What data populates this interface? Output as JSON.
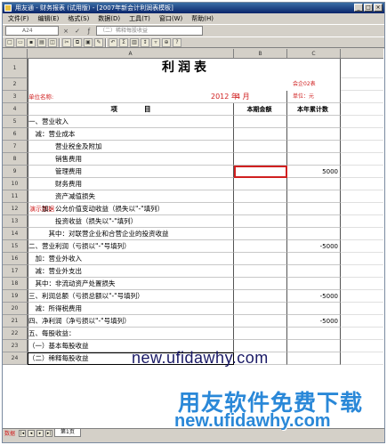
{
  "window": {
    "title": "用友通 - 财务报表 (试用版) - [2007年新会计利润表模板]",
    "buttons": [
      "_",
      "□",
      "×"
    ]
  },
  "menu": [
    "文件(F)",
    "编辑(E)",
    "格式(S)",
    "数据(D)",
    "工具(T)",
    "窗口(W)",
    "帮助(H)"
  ],
  "formula": {
    "cell_ref": "A24",
    "content": "（二）稀释每股收益"
  },
  "toolbar_icons": [
    "new-icon",
    "open-icon",
    "save-icon",
    "print-icon",
    "preview-icon",
    "cut-icon",
    "copy-icon",
    "paste-icon",
    "format-icon",
    "undo-icon",
    "sum-icon",
    "chart-icon",
    "sort-icon",
    "filter-icon",
    "zoom-icon",
    "help-icon"
  ],
  "columns": [
    "A",
    "B",
    "C"
  ],
  "sheet": {
    "title": "利润表",
    "company_label": "单位名称:",
    "year": "2012 年",
    "month": "4 月",
    "form_no": "会企02表",
    "unit": "单位：元",
    "header_item": "项　　　　目",
    "header_current": "本期金额",
    "header_ytd": "本年累计数",
    "demo_label": "演示数据",
    "rows": [
      {
        "n": "5",
        "label": "一、营业收入",
        "b": "",
        "c": ""
      },
      {
        "n": "6",
        "label": "　减：营业成本",
        "b": "",
        "c": ""
      },
      {
        "n": "7",
        "label": "　　　　营业税金及附加",
        "b": "",
        "c": ""
      },
      {
        "n": "8",
        "label": "　　　　销售费用",
        "b": "",
        "c": ""
      },
      {
        "n": "9",
        "label": "　　　　管理费用",
        "b": "",
        "c": "5000"
      },
      {
        "n": "10",
        "label": "　　　　财务费用",
        "b": "",
        "c": ""
      },
      {
        "n": "11",
        "label": "　　　　资产减值损失",
        "b": "",
        "c": ""
      },
      {
        "n": "12",
        "label": "　　加：公允价值变动收益（损失以\"-\"填列）",
        "b": "",
        "c": ""
      },
      {
        "n": "13",
        "label": "　　　　投资收益（损失以\"-\"填列）",
        "b": "",
        "c": ""
      },
      {
        "n": "14",
        "label": "　　　其中：对联营企业和合营企业的投资收益",
        "b": "",
        "c": ""
      },
      {
        "n": "15",
        "label": "二、营业利润（亏损以\"-\"号填列）",
        "b": "",
        "c": "-5000"
      },
      {
        "n": "16",
        "label": "　加：营业外收入",
        "b": "",
        "c": ""
      },
      {
        "n": "17",
        "label": "　减：营业外支出",
        "b": "",
        "c": ""
      },
      {
        "n": "18",
        "label": "　其中：非流动资产处置损失",
        "b": "",
        "c": ""
      },
      {
        "n": "19",
        "label": "三、利润总额（亏损总额以\"-\"号填列）",
        "b": "",
        "c": "-5000"
      },
      {
        "n": "20",
        "label": "　减：所得税费用",
        "b": "",
        "c": ""
      },
      {
        "n": "21",
        "label": "四、净利润（净亏损以\"-\"号填列）",
        "b": "",
        "c": "-5000"
      },
      {
        "n": "22",
        "label": "五、每股收益：",
        "b": "",
        "c": ""
      },
      {
        "n": "23",
        "label": "（一）基本每股收益",
        "b": "",
        "c": ""
      },
      {
        "n": "24",
        "label": "（二）稀释每股收益",
        "b": "",
        "c": ""
      }
    ]
  },
  "tabs": {
    "sheet_tab": "第1页",
    "status_left": "数据"
  },
  "watermarks": {
    "url1": "new.ufidawhy.com",
    "brand": "用友软件免费下载",
    "url2": "new.ufidawhy.com"
  }
}
